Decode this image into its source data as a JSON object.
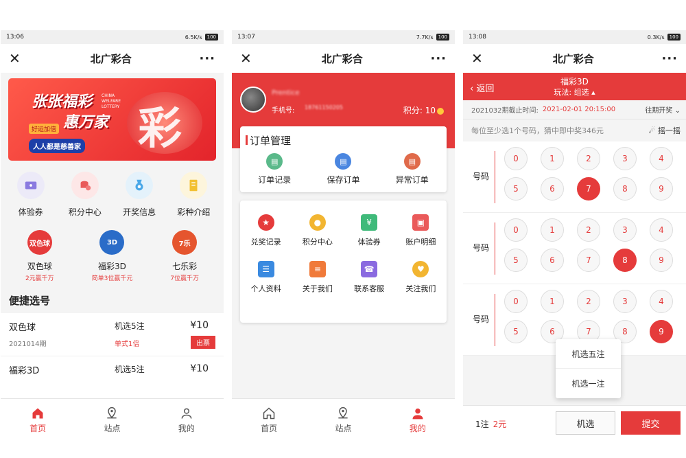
{
  "screen1": {
    "status": {
      "time": "13:06",
      "net": "6.5K/s",
      "battery": "100"
    },
    "title": "北广彩合",
    "banner": {
      "line1": "张张福彩",
      "line2": "惠万家",
      "tag": "好运加倍",
      "slogan": "人人都是慈善家",
      "en": "CHINA WELFARE LOTTERY"
    },
    "grid": [
      {
        "label": "体验券",
        "icon": "ticket-icon",
        "color": "#eceaf8"
      },
      {
        "label": "积分中心",
        "icon": "coins-icon",
        "color": "#fde7e7"
      },
      {
        "label": "开奖信息",
        "icon": "medal-icon",
        "color": "#e4f2fb"
      },
      {
        "label": "彩种介绍",
        "icon": "book-icon",
        "color": "#fdf5dc"
      }
    ],
    "lottos": [
      {
        "name": "双色球",
        "desc": "2元赢千万",
        "badge": "双色球",
        "color": "#e53b3b"
      },
      {
        "name": "福彩3D",
        "desc": "简单3位赢千元",
        "badge": "3D",
        "color": "#2a6cc8"
      },
      {
        "name": "七乐彩",
        "desc": "7位赢千万",
        "badge": "7乐",
        "color": "#e5552e"
      }
    ],
    "quick_title": "便捷选号",
    "quick_rows": [
      {
        "name": "双色球",
        "issue": "2021014期",
        "pick": "机选5注",
        "type": "单式1倍",
        "price": "¥10",
        "button": "出票"
      },
      {
        "name": "福彩3D",
        "issue": "",
        "pick": "机选5注",
        "type": "",
        "price": "¥10",
        "button": ""
      }
    ],
    "tabs": [
      "首页",
      "站点",
      "我的"
    ]
  },
  "screen2": {
    "status": {
      "time": "13:07",
      "net": "7.7K/s",
      "battery": "100"
    },
    "title": "北广彩合",
    "user": {
      "name": "Prentice",
      "phone_label": "手机号:",
      "phone": "18761150205",
      "points_label": "积分:",
      "points": "10"
    },
    "order_title": "订单管理",
    "orders": [
      {
        "label": "订单记录",
        "color": "#5ab98a"
      },
      {
        "label": "保存订单",
        "color": "#4a86e0"
      },
      {
        "label": "异常订单",
        "color": "#e06a4a"
      }
    ],
    "menu": [
      {
        "label": "兑奖记录",
        "color": "#e53b3b",
        "glyph": "★"
      },
      {
        "label": "积分中心",
        "color": "#f2b531",
        "glyph": "●"
      },
      {
        "label": "体验券",
        "color": "#3fba7a",
        "glyph": "¥"
      },
      {
        "label": "账户明细",
        "color": "#ea5a5a",
        "glyph": "▣"
      },
      {
        "label": "个人资料",
        "color": "#3a8ae0",
        "glyph": "☰"
      },
      {
        "label": "关于我们",
        "color": "#f07a3a",
        "glyph": "≡"
      },
      {
        "label": "联系客服",
        "color": "#8a6ae0",
        "glyph": "☎"
      },
      {
        "label": "关注我们",
        "color": "#f2b531",
        "glyph": "♥"
      }
    ],
    "tabs": [
      "首页",
      "站点",
      "我的"
    ]
  },
  "screen3": {
    "status": {
      "time": "13:08",
      "net": "0.3K/s",
      "battery": "100"
    },
    "title": "北广彩合",
    "back": "返回",
    "game": "福彩3D",
    "mode": "玩法: 组选",
    "issue": "2021032期截止时间:",
    "deadline": "2021-02-01 20:15:00",
    "past": "往期开奖",
    "rule": "每位至少选1个号码，猜中即中奖346元",
    "shake": "摇一摇",
    "rows": [
      {
        "label": "号码",
        "selected": 7
      },
      {
        "label": "号码",
        "selected": 8
      },
      {
        "label": "号码",
        "selected": 9
      }
    ],
    "digits": [
      "0",
      "1",
      "2",
      "3",
      "4",
      "5",
      "6",
      "7",
      "8",
      "9"
    ],
    "popup": [
      "机选五注",
      "机选一注"
    ],
    "count": "1注",
    "amount": "2元",
    "machine": "机选",
    "submit": "提交"
  }
}
